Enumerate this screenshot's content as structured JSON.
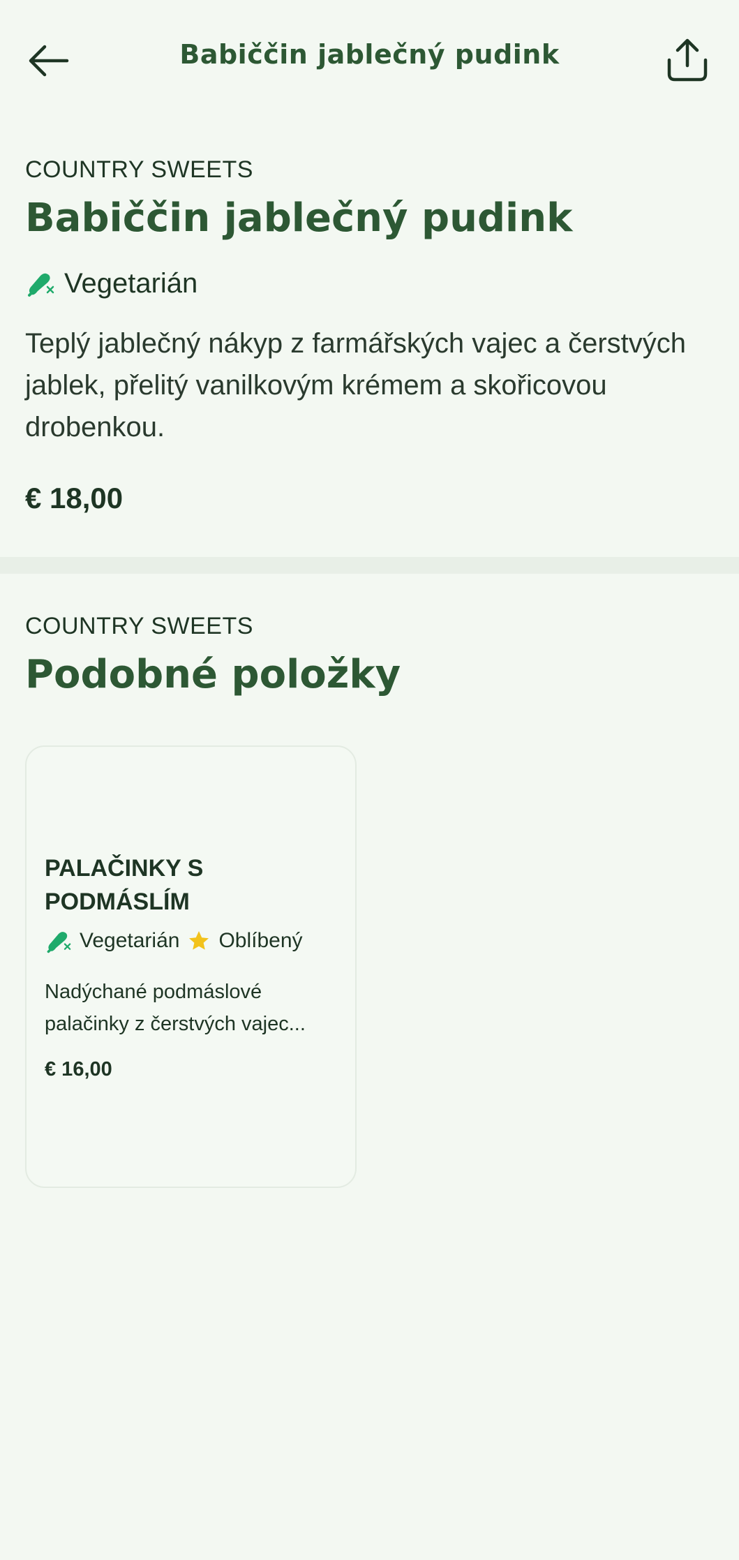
{
  "header": {
    "title": "Babiččin jablečný pudink",
    "back_icon": "arrow-left-icon",
    "share_icon": "share-icon"
  },
  "product": {
    "category": "COUNTRY SWEETS",
    "name": "Babiččin jablečný pudink",
    "tag": "Vegetarián",
    "tag_icon": "vegetarian-icon",
    "description": "Teplý jablečný nákyp z farmářských vajec a čerstvých jablek, přelitý vanilkovým krémem a skořicovou drobenkou.",
    "price": "€ 18,00"
  },
  "similar": {
    "category": "COUNTRY SWEETS",
    "title": "Podobné položky",
    "items": [
      {
        "name": "PALAČINKY S PODMÁSLÍM",
        "tags": [
          "Vegetarián",
          "Oblíbený"
        ],
        "description_lines": [
          "Nadýchané podmáslové",
          "palačinky z čerstvých vajec..."
        ],
        "price": "€ 16,00"
      }
    ]
  },
  "colors": {
    "background": "#f3f8f2",
    "brand_green": "#2d5834",
    "icon_green": "#1faa6b",
    "star_yellow": "#f2c21b",
    "divider": "#e8efe7"
  }
}
